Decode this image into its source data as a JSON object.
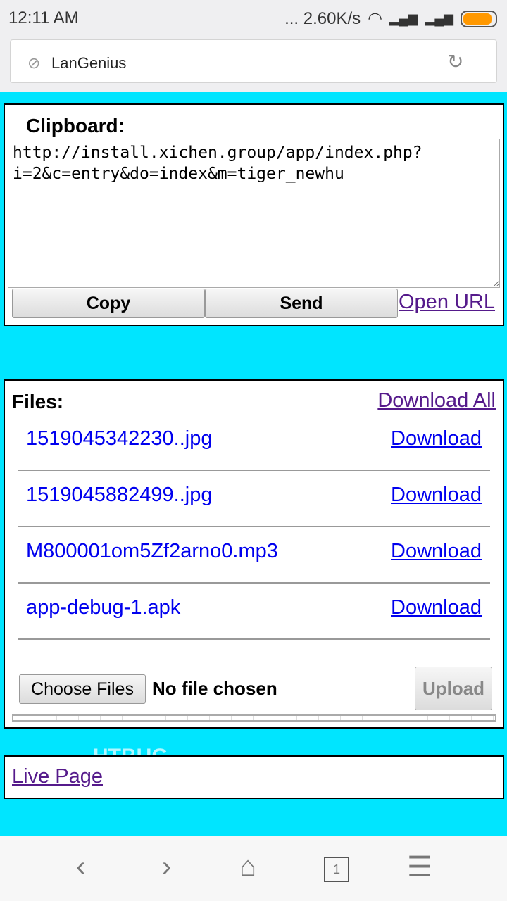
{
  "status": {
    "time": "12:11  AM",
    "speed": "... 2.60K/s",
    "battery_level": 0.9
  },
  "browser": {
    "title": "LanGenius"
  },
  "clipboard": {
    "heading": "Clipboard:",
    "text": "http://install.xichen.group/app/index.php?i=2&c=entry&do=index&m=tiger_newhu",
    "copy": "Copy",
    "send": "Send",
    "open_url": "Open URL"
  },
  "files": {
    "heading": "Files:",
    "download_all": "Download All",
    "items": [
      {
        "name": "1519045342230..jpg",
        "action": "Download"
      },
      {
        "name": "1519045882499..jpg",
        "action": "Download"
      },
      {
        "name": "M800001om5Zf2arno0.mp3",
        "action": "Download"
      },
      {
        "name": "app-debug-1.apk",
        "action": "Download"
      }
    ],
    "choose": "Choose Files",
    "no_file": "No file chosen",
    "upload": "Upload",
    "upload_progress": 0
  },
  "live": {
    "link": "Live Page"
  },
  "nav": {
    "tabs_count": "1"
  }
}
